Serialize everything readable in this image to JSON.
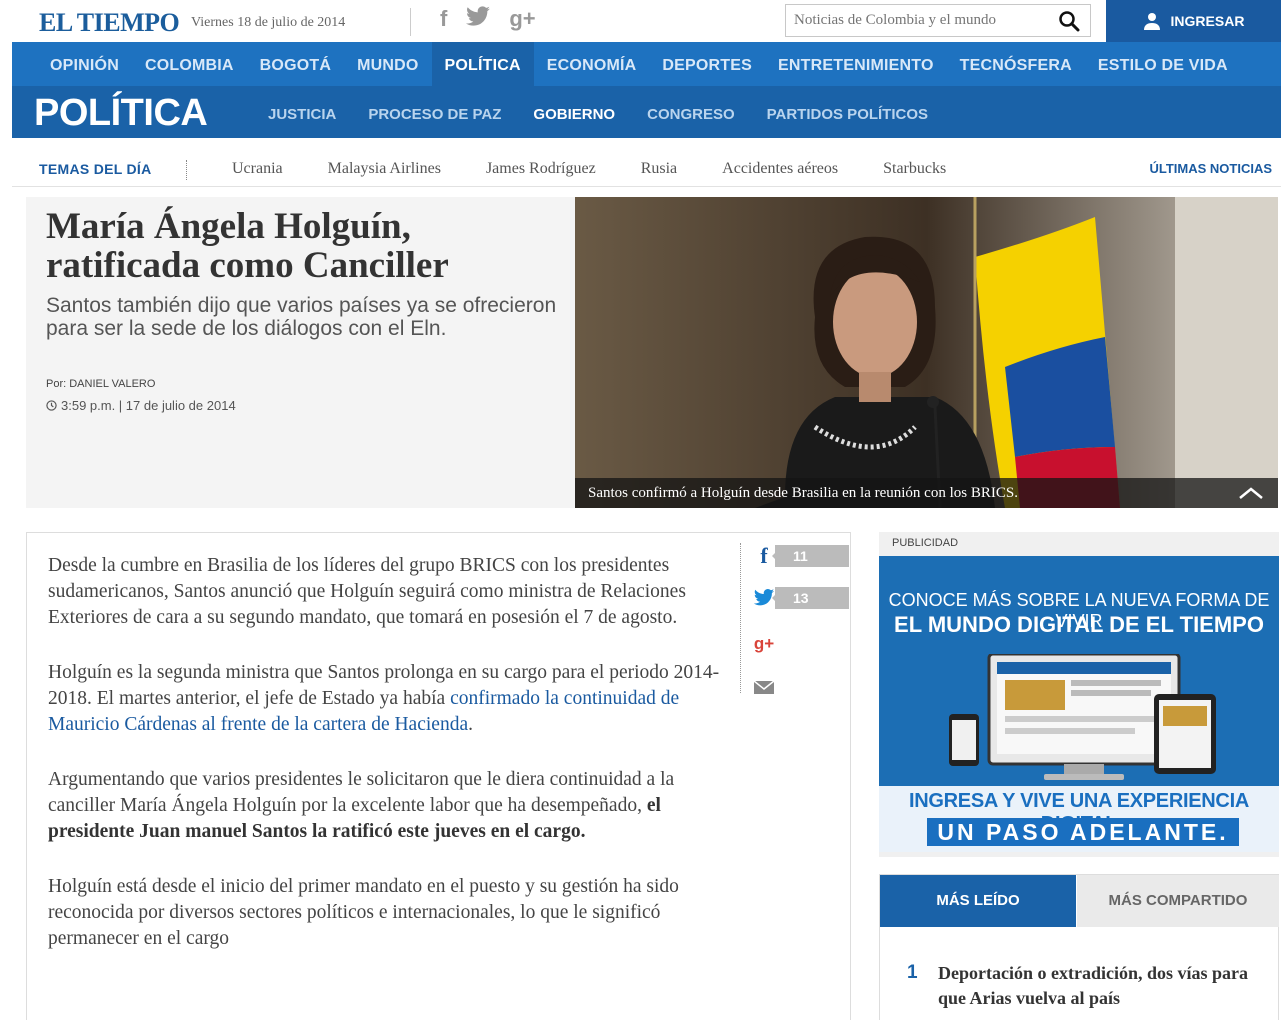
{
  "header": {
    "logo": "EL TIEMPO",
    "date": "Viernes 18 de julio de 2014",
    "social": {
      "facebook": "f",
      "twitter": "twitter-bird",
      "googleplus": "g+"
    },
    "search_placeholder": "Noticias de Colombia y el mundo",
    "login_label": "INGRESAR"
  },
  "main_nav": [
    {
      "label": "OPINIÓN",
      "active": false
    },
    {
      "label": "COLOMBIA",
      "active": false
    },
    {
      "label": "BOGOTÁ",
      "active": false
    },
    {
      "label": "MUNDO",
      "active": false
    },
    {
      "label": "POLÍTICA",
      "active": true
    },
    {
      "label": "ECONOMÍA",
      "active": false
    },
    {
      "label": "DEPORTES",
      "active": false
    },
    {
      "label": "ENTRETENIMIENTO",
      "active": false
    },
    {
      "label": "TECNÓSFERA",
      "active": false
    },
    {
      "label": "ESTILO DE VIDA",
      "active": false
    }
  ],
  "section": {
    "title": "POLÍTICA",
    "subnav": [
      {
        "label": "JUSTICIA",
        "active": false
      },
      {
        "label": "PROCESO DE PAZ",
        "active": false
      },
      {
        "label": "GOBIERNO",
        "active": true
      },
      {
        "label": "CONGRESO",
        "active": false
      },
      {
        "label": "PARTIDOS POLÍTICOS",
        "active": false
      }
    ]
  },
  "temas": {
    "label": "TEMAS DEL DÍA",
    "items": [
      "Ucrania",
      "Malaysia Airlines",
      "James Rodríguez",
      "Rusia",
      "Accidentes aéreos",
      "Starbucks"
    ],
    "ultimas": "ÚLTIMAS NOTICIAS"
  },
  "hero": {
    "title": "María Ángela Holguín, ratificada como Canciller",
    "subtitle": "Santos también dijo que varios países ya se ofrecieron para ser la sede de los diálogos con el Eln.",
    "byline": "Por: DANIEL VALERO",
    "datetime": "3:59 p.m. | 17 de julio de 2014",
    "caption": "Santos confirmó a Holguín desde Brasilia en la reunión con los BRICS."
  },
  "article": {
    "p1": "Desde la cumbre en Brasilia de los líderes del grupo BRICS con los presidentes sudamericanos, Santos anunció que Holguín seguirá como ministra de Relaciones Exteriores de cara a su segundo mandato, que tomará en posesión el 7 de agosto.",
    "p2_text": "Holguín es la segunda ministra que Santos prolonga en su cargo para el periodo 2014-2018. El martes anterior, el jefe de Estado ya había ",
    "p2_link": "confirmado la continuidad de Mauricio Cárdenas al frente de la cartera de Hacienda",
    "p2_end": ".",
    "p3_text": "Argumentando que varios presidentes le solicitaron que le diera continuidad a la canciller María Ángela Holguín por la excelente labor que ha desempeñado, ",
    "p3_bold": "el presidente Juan manuel Santos la ratificó este jueves en el cargo.",
    "p4": "Holguín está desde el inicio del primer mandato en el puesto y su gestión ha sido reconocida por diversos sectores políticos e internacionales, lo que le significó permanecer en el cargo"
  },
  "share": {
    "facebook_count": "11",
    "twitter_count": "13"
  },
  "ad": {
    "label": "PUBLICIDAD",
    "line1": "CONOCE MÁS SOBRE LA NUEVA FORMA DE VIVIR",
    "line2": "EL MUNDO DIGITAL DE EL TIEMPO",
    "line3": "INGRESA Y VIVE UNA EXPERIENCIA DIGITAL",
    "line4": "UN PASO ADELANTE."
  },
  "tabs": {
    "active": "MÁS LEÍDO",
    "inactive": "MÁS COMPARTIDO",
    "items": [
      {
        "rank": "1",
        "title": "Deportación o extradición, dos vías para que Arias vuelva al país"
      }
    ]
  },
  "colors": {
    "nav_blue": "#1e72c0",
    "section_blue": "#1a62a8",
    "logo_blue": "#1b5d9c"
  }
}
